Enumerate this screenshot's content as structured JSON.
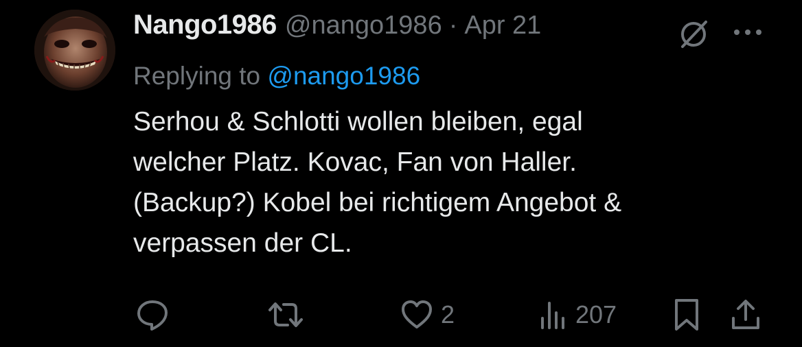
{
  "tweet": {
    "author": {
      "display_name": "Nango1986",
      "handle": "@nango1986"
    },
    "separator": "·",
    "date": "Apr 21",
    "replying_prefix": "Replying to",
    "replying_to": "@nango1986",
    "text_lines": [
      "Serhou & Schlotti wollen bleiben, egal",
      "welcher Platz. Kovac, Fan von Haller.",
      "(Backup?) Kobel bei richtigem Angebot &",
      "verpassen der CL."
    ]
  },
  "actions": {
    "reply": {
      "icon": "reply-icon",
      "count": ""
    },
    "repost": {
      "icon": "repost-icon",
      "count": ""
    },
    "like": {
      "icon": "heart-icon",
      "count": "2"
    },
    "views": {
      "icon": "views-icon",
      "count": "207"
    },
    "bookmark": {
      "icon": "bookmark-icon"
    },
    "share": {
      "icon": "share-icon"
    }
  },
  "colors": {
    "background": "#000000",
    "primary_text": "#e7e9ea",
    "secondary_text": "#71767b",
    "accent": "#1d9bf0"
  }
}
